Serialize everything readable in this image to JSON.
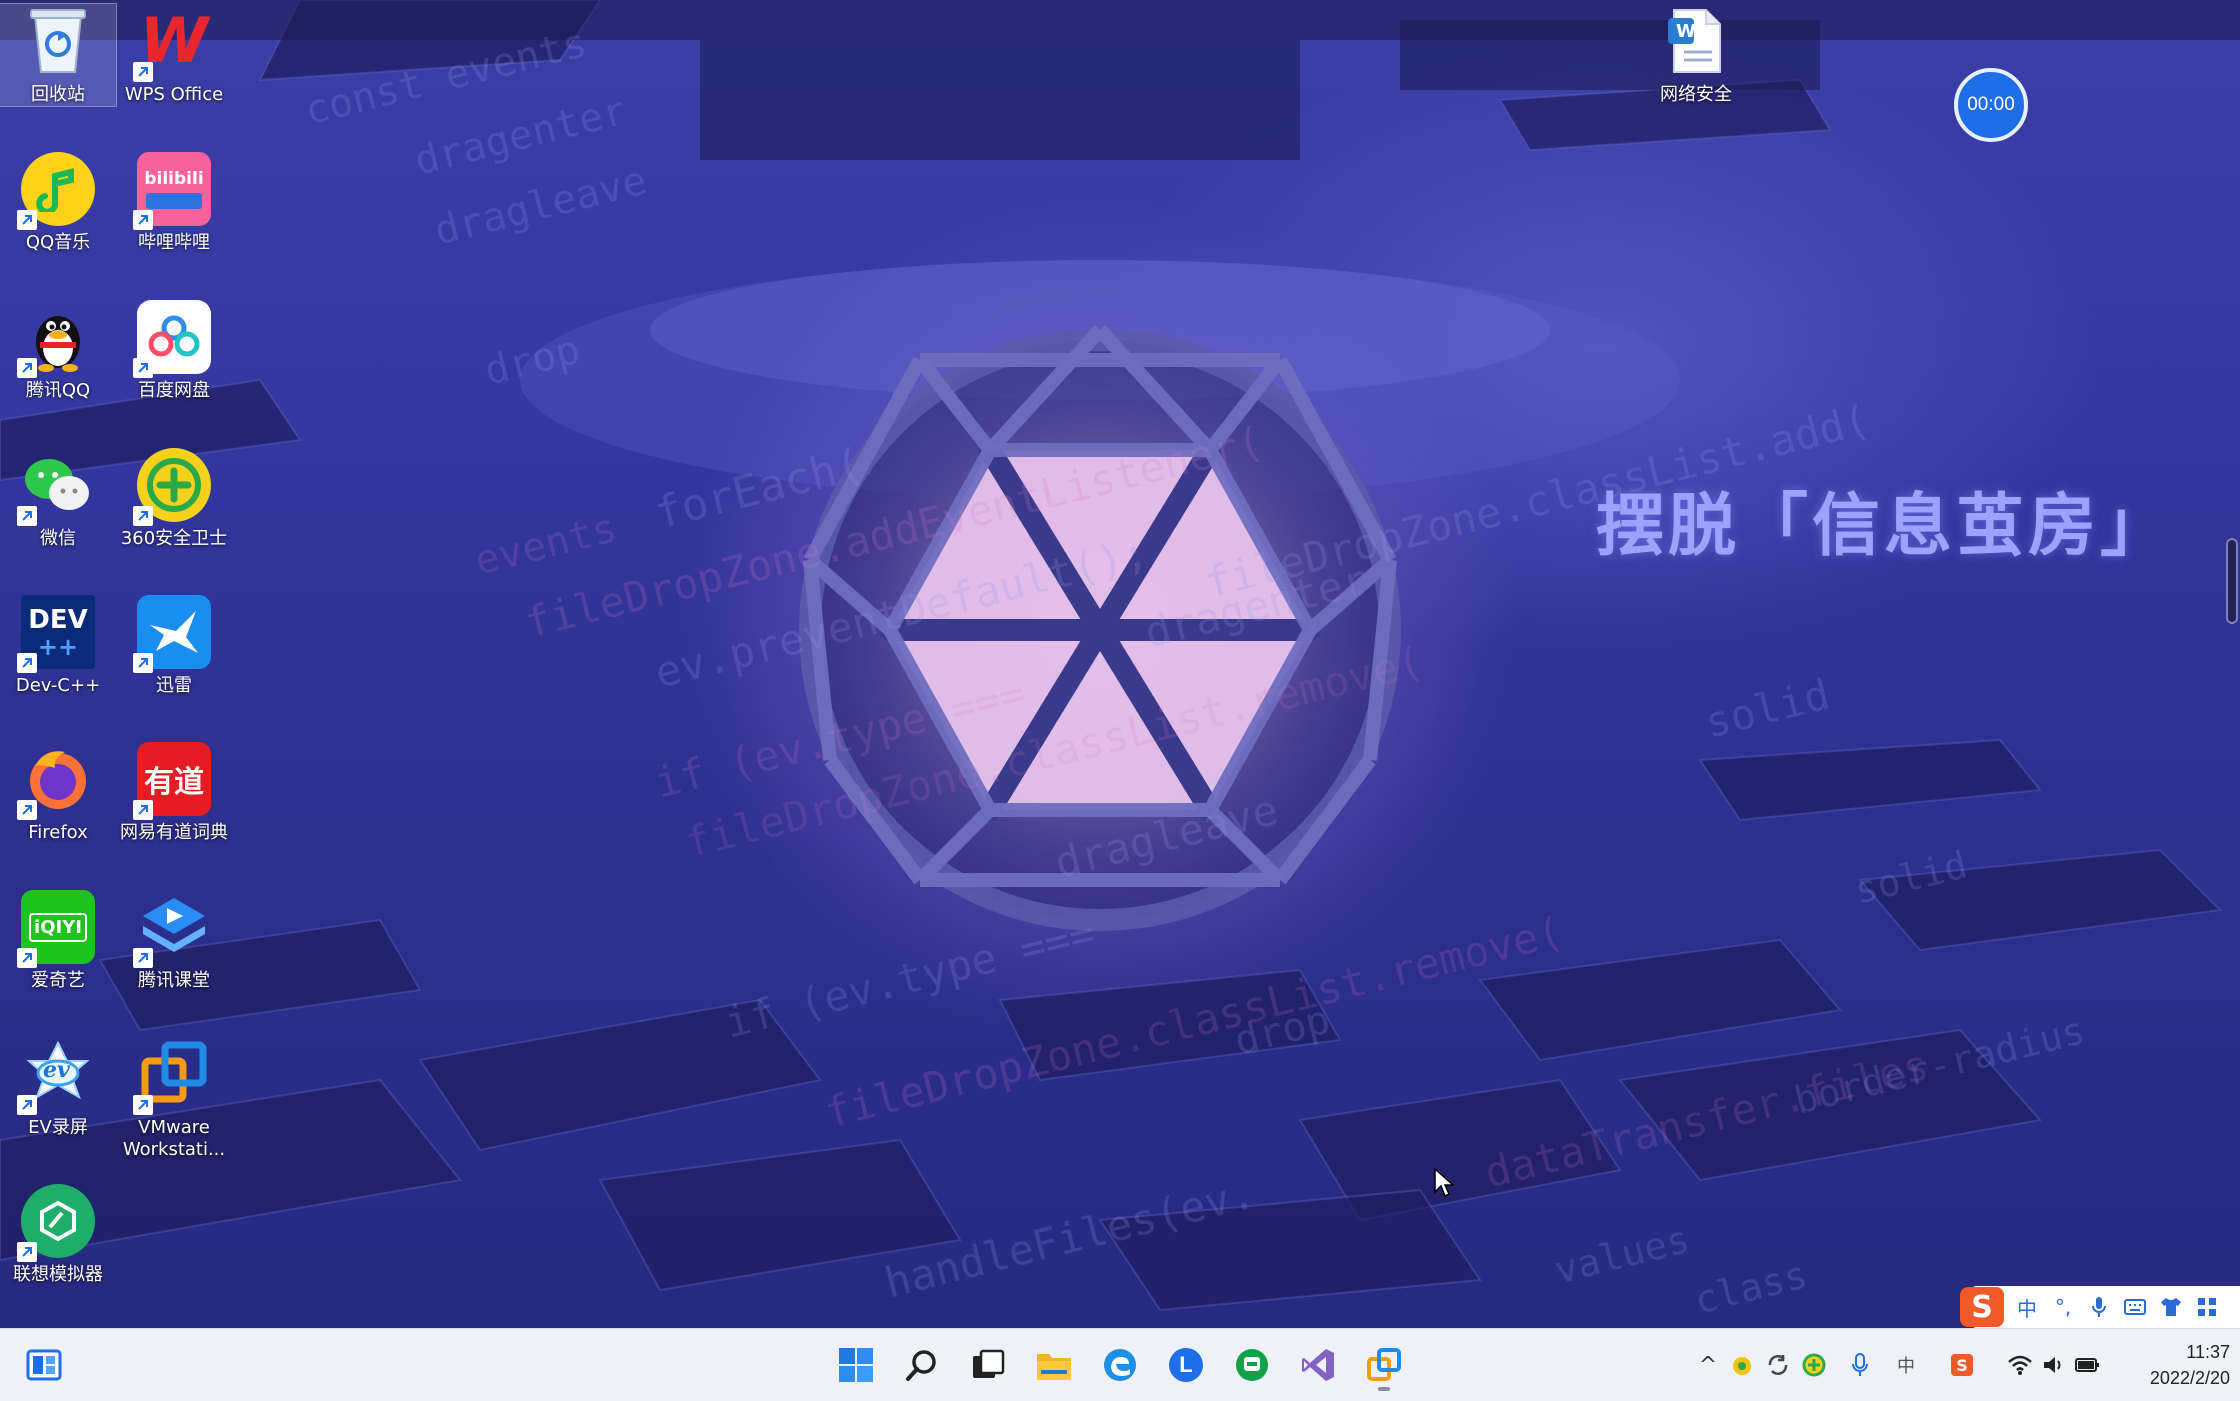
{
  "desktop": {
    "icons": [
      {
        "label": "回收站",
        "icon": "recycle-bin-icon"
      },
      {
        "label": "WPS Office",
        "icon": "wps-office-icon"
      },
      {
        "label": "QQ音乐",
        "icon": "qq-music-icon"
      },
      {
        "label": "哔哩哔哩",
        "icon": "bilibili-icon"
      },
      {
        "label": "腾讯QQ",
        "icon": "tencent-qq-icon"
      },
      {
        "label": "百度网盘",
        "icon": "baidu-netdisk-icon"
      },
      {
        "label": "微信",
        "icon": "wechat-icon"
      },
      {
        "label": "360安全卫士",
        "icon": "360-security-icon"
      },
      {
        "label": "Dev-C++",
        "icon": "dev-cpp-icon"
      },
      {
        "label": "迅雷",
        "icon": "xunlei-icon"
      },
      {
        "label": "Firefox",
        "icon": "firefox-icon"
      },
      {
        "label": "网易有道词典",
        "icon": "youdao-dict-icon"
      },
      {
        "label": "爱奇艺",
        "icon": "iqiyi-icon"
      },
      {
        "label": "腾讯课堂",
        "icon": "tencent-classroom-icon"
      },
      {
        "label": "EV录屏",
        "icon": "ev-recorder-icon"
      },
      {
        "label": "VMware Workstati...",
        "icon": "vmware-icon"
      },
      {
        "label": "联想模拟器",
        "icon": "lenovo-emulator-icon"
      },
      {
        "label": "网络安全",
        "icon": "word-document-icon"
      }
    ],
    "icon_glyphs": {
      "wps": "W",
      "bilibili": "bilibili",
      "dev": "DEV",
      "iqiyi": "iQIYI",
      "youdao": "有道",
      "ev": "ev",
      "word": "W"
    },
    "headline": "摆脱「信息茧房」",
    "timer": "00:00",
    "wallpaper_code": [
      "const events",
      "dragenter",
      "dragleave",
      "drop",
      "forEach(",
      "events",
      "fileDropZone.addEventListener(",
      "ev.preventDefault();",
      "dragenter",
      "if (ev.type ===",
      "fileDropZone.classList.add(",
      "dragleave",
      "fileDropZone.classList.remove(",
      "drop",
      "if (ev.type ===",
      "fileDropZone.classList.remove(",
      "solid",
      "dataTransfer.files",
      "handleFiles(ev.",
      "values",
      "class",
      "border-radius",
      "solid"
    ]
  },
  "ime": {
    "items": [
      "中",
      "°,",
      "mic",
      "keyboard",
      "shirt",
      "grid"
    ]
  },
  "taskbar": {
    "apps": [
      {
        "name": "start-button",
        "icon": "windows-logo-icon"
      },
      {
        "name": "search-button",
        "icon": "search-icon"
      },
      {
        "name": "task-view-button",
        "icon": "task-view-icon"
      },
      {
        "name": "file-explorer-button",
        "icon": "folder-icon"
      },
      {
        "name": "edge-button",
        "icon": "edge-icon"
      },
      {
        "name": "l-app-button",
        "icon": "l-app-icon"
      },
      {
        "name": "green-app-button",
        "icon": "green-app-icon"
      },
      {
        "name": "visual-studio-button",
        "icon": "visual-studio-icon"
      },
      {
        "name": "vmware-button",
        "icon": "vmware-icon"
      }
    ],
    "l_glyph": "L",
    "tray_glyphs": {
      "chevron": "^",
      "ime_lang": "中"
    },
    "clock": {
      "time": "11:37",
      "date": "2022/2/20"
    }
  },
  "colors": {
    "accent": "#1e6ee8",
    "headline": "#9aa3ff",
    "taskbar_bg": "#eef1f7"
  }
}
